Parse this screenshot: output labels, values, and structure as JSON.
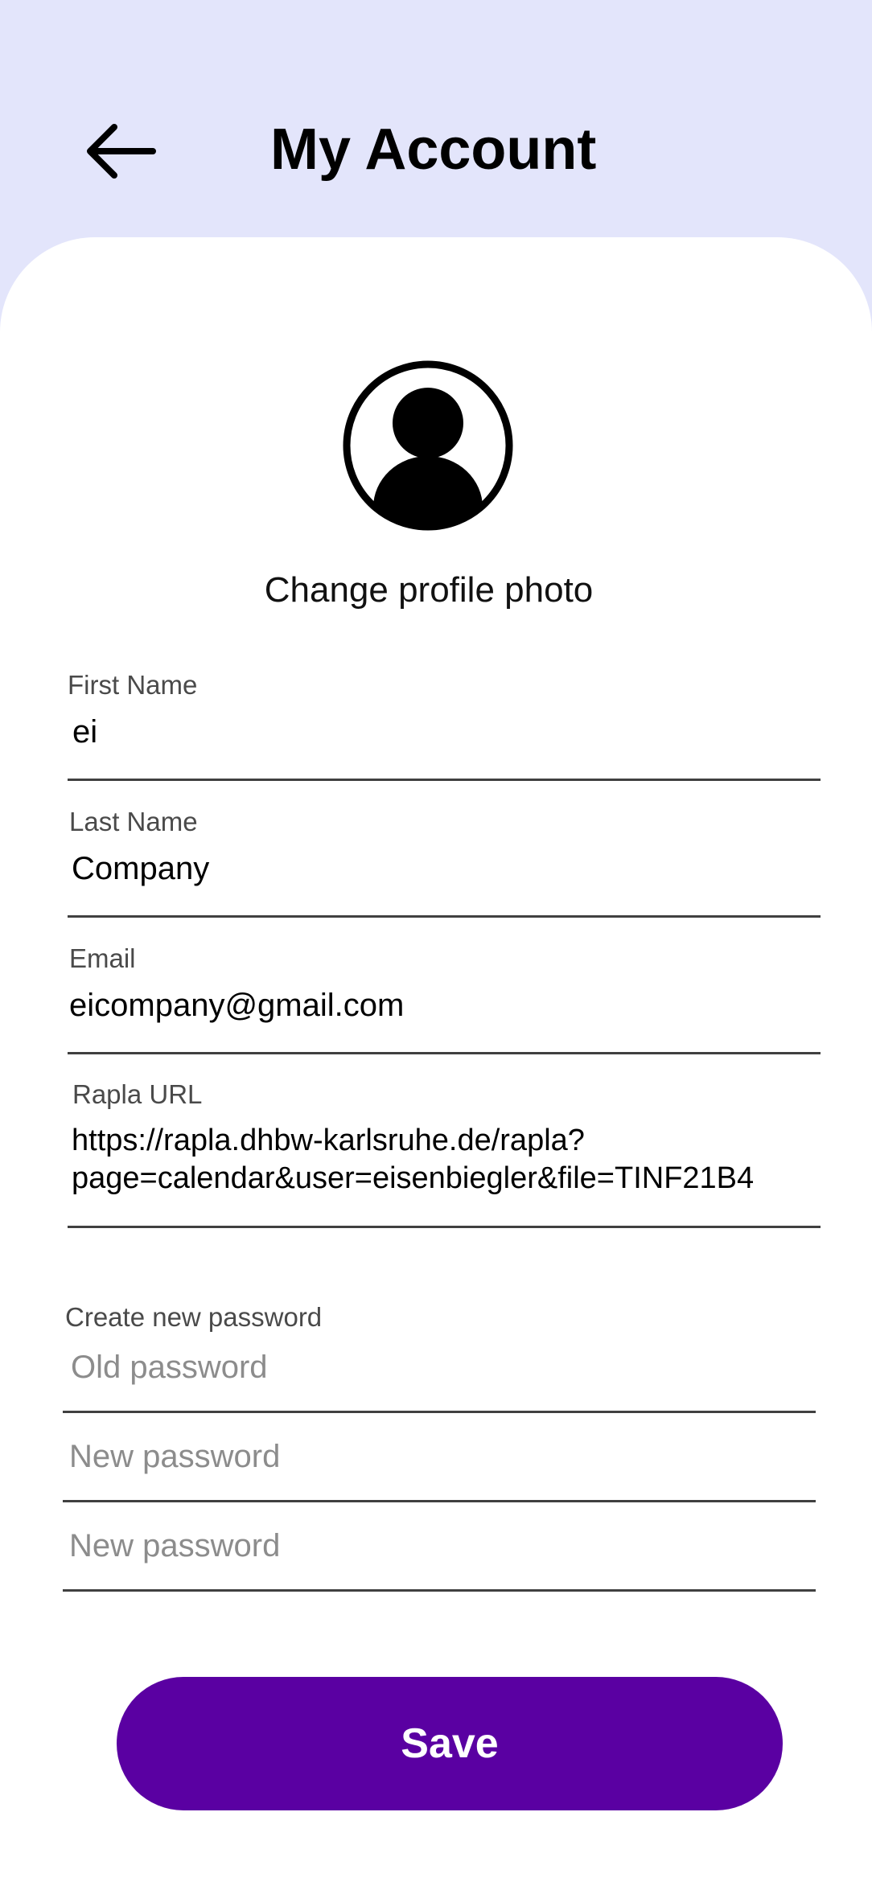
{
  "header": {
    "title": "My Account",
    "back_icon": "arrow-left-icon"
  },
  "profile": {
    "avatar_icon": "user-avatar-icon",
    "change_photo_label": "Change profile photo"
  },
  "fields": {
    "first_name": {
      "label": "First Name",
      "value": "ei"
    },
    "last_name": {
      "label": "Last Name",
      "value": "Company"
    },
    "email": {
      "label": "Email",
      "value": "eicompany@gmail.com"
    },
    "rapla_url": {
      "label": "Rapla URL",
      "value": "https://rapla.dhbw-karlsruhe.de/rapla?\npage=calendar&user=eisenbiegler&file=TINF21B4"
    }
  },
  "password": {
    "section_label": "Create new password",
    "old_placeholder": "Old password",
    "new_placeholder": "New password",
    "confirm_placeholder": "New password"
  },
  "actions": {
    "save_label": "Save"
  },
  "colors": {
    "header_background": "#e3e5fb",
    "card_background": "#ffffff",
    "primary": "#5a00a2",
    "underline": "#404040",
    "label": "#4a4a4a",
    "placeholder": "#8c8c8c"
  }
}
